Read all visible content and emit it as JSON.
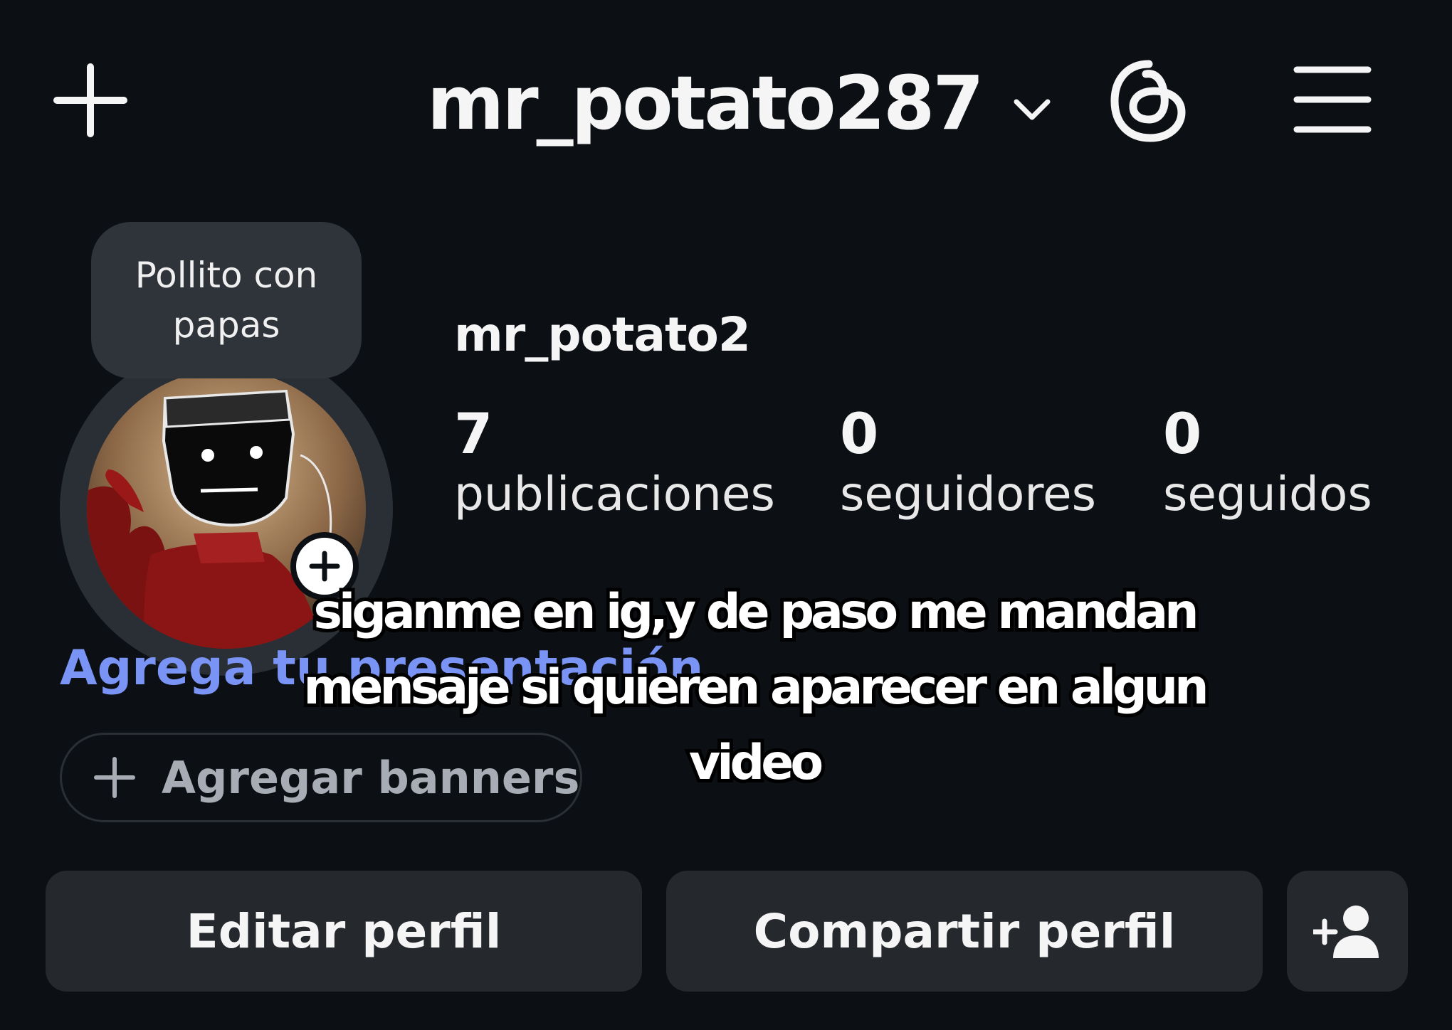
{
  "header": {
    "create_icon": "plus-icon",
    "username": "mr_potato287",
    "account_switch_icon": "chevron-down-icon",
    "threads_icon": "threads-icon",
    "menu_icon": "hamburger-menu-icon"
  },
  "profile": {
    "note": "Pollito con papas",
    "display_name": "mr_potato2",
    "add_story_icon": "plus-icon",
    "stats": [
      {
        "value": "7",
        "label": "publicaciones"
      },
      {
        "value": "0",
        "label": "seguidores"
      },
      {
        "value": "0",
        "label": "seguidos"
      }
    ],
    "add_bio_label": "Agrega tu presentación",
    "add_banners_label": "Agregar banners"
  },
  "actions": {
    "edit_label": "Editar perfil",
    "share_label": "Compartir perfil",
    "discover_icon": "add-person-icon"
  },
  "overlay_caption": "siganme en ig,y de paso me mandan mensaje si quieren aparecer en algun video",
  "colors": {
    "background": "#0c1014",
    "button": "#25292e",
    "link": "#7a94f5",
    "note_bubble": "#2f343b"
  }
}
